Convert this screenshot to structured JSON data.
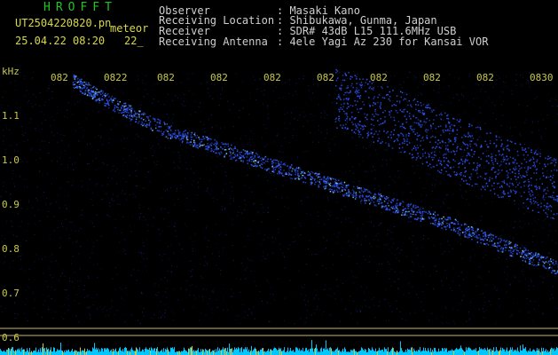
{
  "header": {
    "brand": "HROFFT",
    "filename": "UT2504220820.pn",
    "tag": "meteor",
    "datetime": "25.04.22 08:20",
    "suffix": "22_",
    "labels": {
      "observer": "Observer",
      "location": "Receiving Location",
      "receiver": "Receiver",
      "antenna": "Receiving Antenna"
    },
    "values": {
      "observer": ": Masaki Kano",
      "location": ": Shibukawa, Gunma, Japan",
      "receiver": ": SDR# 43dB L15 111.6MHz USB",
      "antenna": ": 4ele Yagi Az 230 for Kansai VOR"
    }
  },
  "axis": {
    "unit": "kHz",
    "y_ticks": [
      "1.1",
      "1.0",
      "0.9",
      "0.8",
      "0.7",
      "0.6"
    ],
    "x_ticks": [
      "082",
      "0822",
      "082",
      "082",
      "082",
      "082",
      "082",
      "082",
      "082",
      "0830"
    ]
  },
  "colors": {
    "background": "#000000",
    "signal": "#2f56ff",
    "signal_bright": "#7fd4ff",
    "noise_floor": "#00c8ff",
    "marker_line": "#c8b46a"
  },
  "chart_data": {
    "type": "scatter",
    "title": "",
    "xlabel": "",
    "ylabel": "kHz",
    "ylim": [
      0.58,
      1.18
    ],
    "xlim": [
      0,
      10
    ],
    "series": [
      {
        "values_desc": "main meteor trail",
        "points": [
          [
            1.3,
            1.16
          ],
          [
            2.0,
            1.11
          ],
          [
            3.0,
            1.05
          ],
          [
            4.0,
            1.01
          ],
          [
            5.0,
            0.97
          ],
          [
            6.0,
            0.93
          ],
          [
            7.0,
            0.89
          ],
          [
            8.0,
            0.85
          ],
          [
            9.0,
            0.8
          ],
          [
            10.0,
            0.75
          ]
        ]
      },
      {
        "values_desc": "faint upper trail",
        "points": [
          [
            6.0,
            1.12
          ],
          [
            7.0,
            1.08
          ],
          [
            8.0,
            1.02
          ],
          [
            9.0,
            0.97
          ],
          [
            10.0,
            0.92
          ]
        ]
      }
    ]
  }
}
